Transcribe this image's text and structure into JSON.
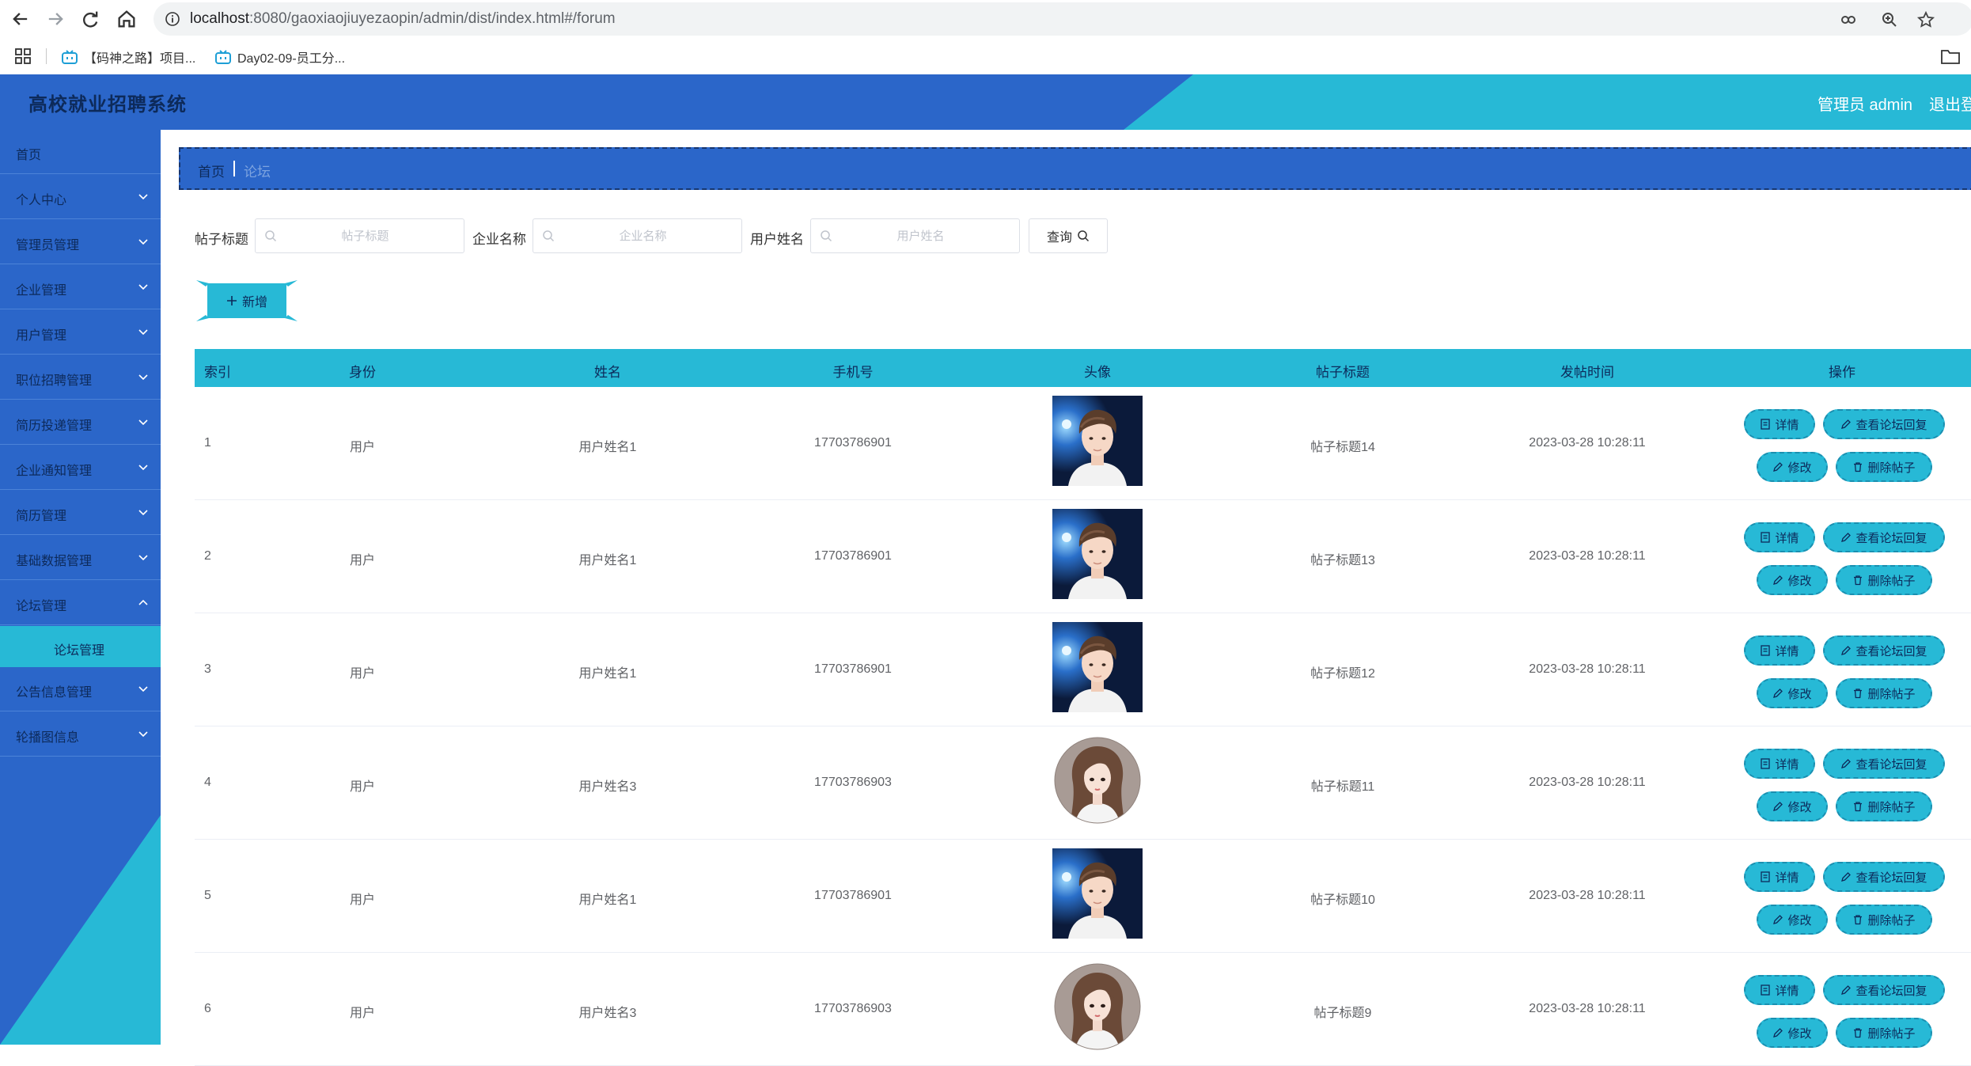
{
  "browser": {
    "url_host": "localhost",
    "url_path": ":8080/gaoxiaojiuyezaopin/admin/dist/index.html#/forum",
    "bookmarks": [
      {
        "label": "【码神之路】项目..."
      },
      {
        "label": "Day02-09-员工分..."
      }
    ]
  },
  "header": {
    "title": "高校就业招聘系统",
    "user": "管理员 admin",
    "logout": "退出登录"
  },
  "sidebar": {
    "items": [
      {
        "label": "首页"
      },
      {
        "label": "个人中心"
      },
      {
        "label": "管理员管理"
      },
      {
        "label": "企业管理"
      },
      {
        "label": "用户管理"
      },
      {
        "label": "职位招聘管理"
      },
      {
        "label": "简历投递管理"
      },
      {
        "label": "企业通知管理"
      },
      {
        "label": "简历管理"
      },
      {
        "label": "基础数据管理"
      },
      {
        "label": "论坛管理"
      },
      {
        "label": "公告信息管理"
      },
      {
        "label": "轮播图信息"
      }
    ],
    "active_sub": "论坛管理"
  },
  "breadcrumb": {
    "home": "首页",
    "current": "论坛"
  },
  "search": {
    "fields": [
      {
        "label": "帖子标题",
        "placeholder": "帖子标题"
      },
      {
        "label": "企业名称",
        "placeholder": "企业名称"
      },
      {
        "label": "用户姓名",
        "placeholder": "用户姓名"
      }
    ],
    "query_label": "查询"
  },
  "actions": {
    "add_label": "新增"
  },
  "table": {
    "headers": [
      "索引",
      "身份",
      "姓名",
      "手机号",
      "头像",
      "帖子标题",
      "发帖时间",
      "操作"
    ],
    "rows": [
      {
        "index": "1",
        "role": "用户",
        "name": "用户姓名1",
        "phone": "17703786901",
        "avatar": "male-avatar",
        "title": "帖子标题14",
        "time": "2023-03-28 10:28:11"
      },
      {
        "index": "2",
        "role": "用户",
        "name": "用户姓名1",
        "phone": "17703786901",
        "avatar": "male-avatar",
        "title": "帖子标题13",
        "time": "2023-03-28 10:28:11"
      },
      {
        "index": "3",
        "role": "用户",
        "name": "用户姓名1",
        "phone": "17703786901",
        "avatar": "male-avatar",
        "title": "帖子标题12",
        "time": "2023-03-28 10:28:11"
      },
      {
        "index": "4",
        "role": "用户",
        "name": "用户姓名3",
        "phone": "17703786903",
        "avatar": "female-avatar",
        "title": "帖子标题11",
        "time": "2023-03-28 10:28:11"
      },
      {
        "index": "5",
        "role": "用户",
        "name": "用户姓名1",
        "phone": "17703786901",
        "avatar": "male-avatar",
        "title": "帖子标题10",
        "time": "2023-03-28 10:28:11"
      },
      {
        "index": "6",
        "role": "用户",
        "name": "用户姓名3",
        "phone": "17703786903",
        "avatar": "female-avatar",
        "title": "帖子标题9",
        "time": "2023-03-28 10:28:11"
      }
    ],
    "ops": {
      "detail": "详情",
      "reply": "查看论坛回复",
      "edit": "修改",
      "delete": "删除帖子"
    }
  },
  "colors": {
    "primary": "#2b66c9",
    "accent": "#27b9d6",
    "text_dark": "#0d2a5a"
  }
}
